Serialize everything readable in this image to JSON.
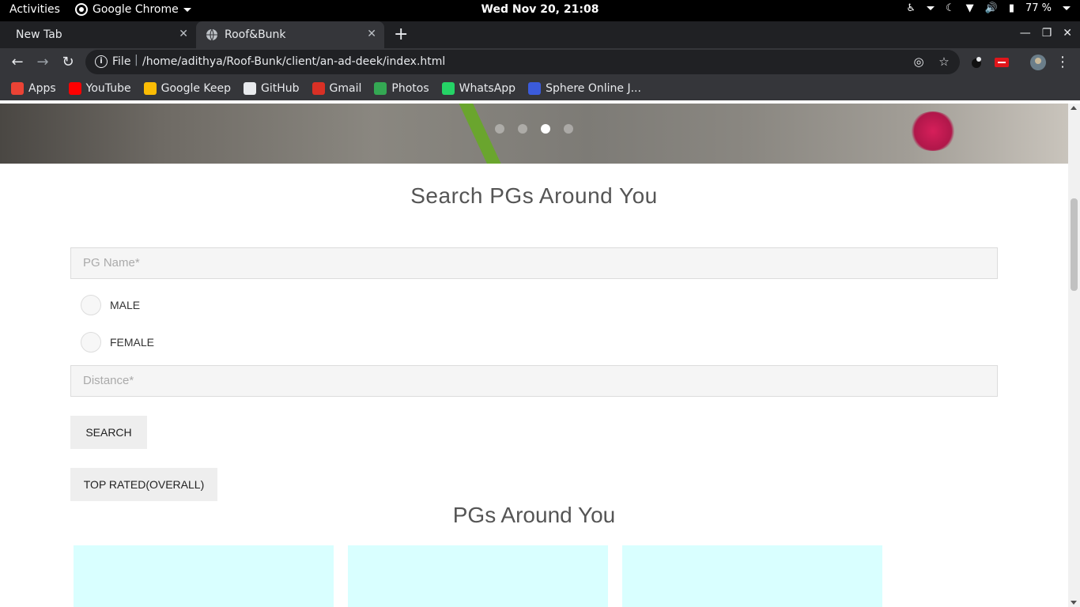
{
  "system_bar": {
    "activities": "Activities",
    "app_name": "Google Chrome",
    "clock": "Wed Nov 20, 21:08",
    "battery": "77 %"
  },
  "tabs": [
    {
      "title": "New Tab",
      "active": false
    },
    {
      "title": "Roof&Bunk",
      "active": true
    }
  ],
  "omnibox": {
    "scheme": "File",
    "url": "/home/adithya/Roof-Bunk/client/an-ad-deek/index.html"
  },
  "bookmarks": [
    {
      "label": "Apps",
      "icon": "apps-grid-icon",
      "color": "#ea4335"
    },
    {
      "label": "YouTube",
      "icon": "youtube-icon",
      "color": "#ff0000"
    },
    {
      "label": "Google Keep",
      "icon": "google-keep-icon",
      "color": "#fbbc04"
    },
    {
      "label": "GitHub",
      "icon": "github-icon",
      "color": "#e8eaed"
    },
    {
      "label": "Gmail",
      "icon": "gmail-icon",
      "color": "#d93025"
    },
    {
      "label": "Photos",
      "icon": "google-photos-icon",
      "color": "#34a853"
    },
    {
      "label": "WhatsApp",
      "icon": "whatsapp-icon",
      "color": "#25d366"
    },
    {
      "label": "Sphere Online J...",
      "icon": "sphere-online-judge-icon",
      "color": "#3b5bdb"
    }
  ],
  "carousel": {
    "slides": 4,
    "active_index": 2
  },
  "search_section": {
    "heading": "Search PGs Around You",
    "pg_name_placeholder": "PG Name*",
    "gender_options": [
      "MALE",
      "FEMALE"
    ],
    "distance_placeholder": "Distance*",
    "search_button": "SEARCH",
    "top_rated_button": "TOP RATED(OVERALL)"
  },
  "results_section": {
    "heading": "PGs Around You",
    "card_color": "#d9ffff",
    "cards": 3
  }
}
